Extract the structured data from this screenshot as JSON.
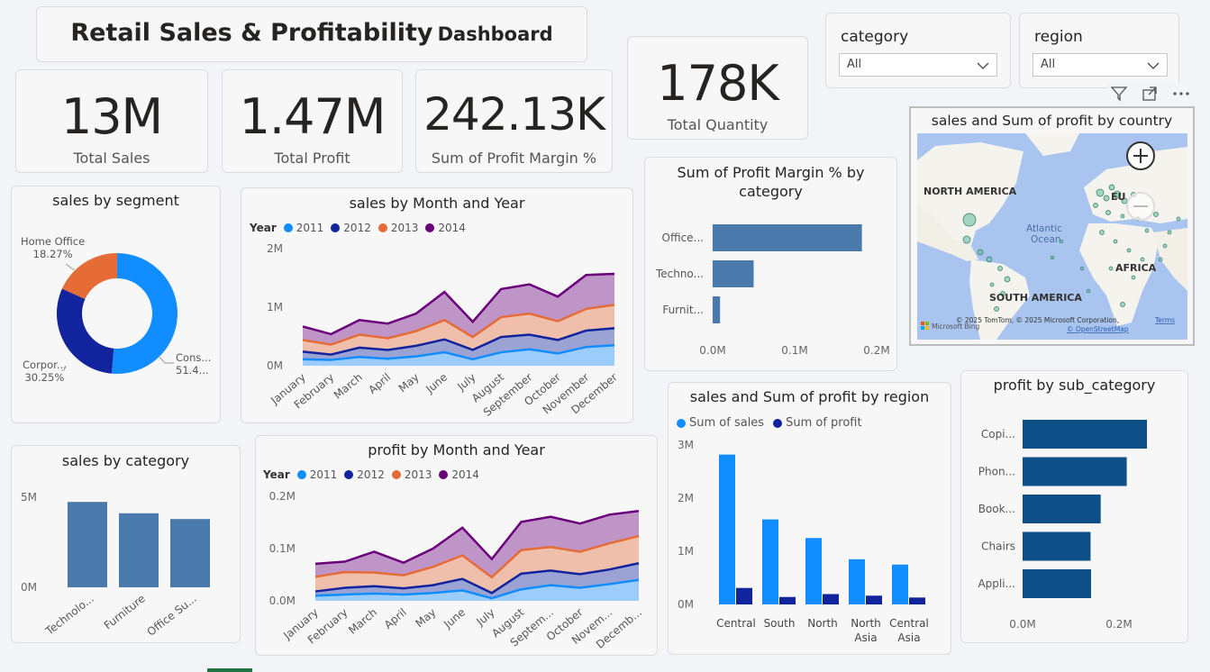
{
  "dashboard": {
    "title_main": "Retail Sales & Profitability",
    "title_sub": "Dashboard"
  },
  "kpis": [
    {
      "value": "13M",
      "label": "Total Sales"
    },
    {
      "value": "1.47M",
      "label": "Total Profit"
    },
    {
      "value": "242.13K",
      "label": "Sum of Profit Margin %"
    },
    {
      "value": "178K",
      "label": "Total Quantity"
    }
  ],
  "slicers": {
    "category": {
      "title": "category",
      "value": "All"
    },
    "region": {
      "title": "region",
      "value": "All"
    }
  },
  "colors": {
    "y2011": "#118dff",
    "y2012": "#12239e",
    "y2013": "#e66c37",
    "y2014": "#6b007b",
    "bar": "#4a7aab",
    "dark_bar": "#0e4f87",
    "sales_bar": "#118dff",
    "profit_bar": "#12239e"
  },
  "segment_chart": {
    "title": "sales by segment",
    "labels": [
      {
        "name": "Home Office",
        "pct": "18.27%"
      },
      {
        "name": "Corpor...",
        "pct": "30.25%"
      },
      {
        "name": "Cons...",
        "pct": "51.4..."
      }
    ],
    "chart_data": {
      "type": "pie",
      "categories": [
        "Consumer",
        "Corporate",
        "Home Office"
      ],
      "values": [
        51.48,
        30.25,
        18.27
      ],
      "colors": [
        "#118dff",
        "#12239e",
        "#e66c37"
      ]
    }
  },
  "sales_month_chart": {
    "title": "sales by Month and Year",
    "legend_title": "Year",
    "chart_data": {
      "type": "area",
      "stacked": true,
      "categories": [
        "January",
        "February",
        "March",
        "April",
        "May",
        "June",
        "July",
        "August",
        "September",
        "October",
        "November",
        "December"
      ],
      "y_ticks": [
        "0M",
        "1M",
        "2M"
      ],
      "ylim": [
        0,
        2000000
      ],
      "series": [
        {
          "name": "2011",
          "values": [
            110000,
            100000,
            150000,
            120000,
            160000,
            230000,
            110000,
            230000,
            280000,
            210000,
            320000,
            350000
          ]
        },
        {
          "name": "2012",
          "values": [
            130000,
            90000,
            160000,
            150000,
            180000,
            220000,
            160000,
            260000,
            250000,
            230000,
            280000,
            290000
          ]
        },
        {
          "name": "2013",
          "values": [
            200000,
            170000,
            220000,
            200000,
            250000,
            330000,
            220000,
            340000,
            360000,
            320000,
            370000,
            400000
          ]
        },
        {
          "name": "2014",
          "values": [
            230000,
            180000,
            250000,
            250000,
            300000,
            480000,
            260000,
            480000,
            500000,
            420000,
            580000,
            530000
          ]
        }
      ]
    }
  },
  "profit_month_chart": {
    "title": "profit by Month and Year",
    "legend_title": "Year",
    "chart_data": {
      "type": "area",
      "stacked": true,
      "categories": [
        "January",
        "February",
        "March",
        "April",
        "May",
        "June",
        "July",
        "August",
        "Septem...",
        "October",
        "Novem...",
        "Decemb..."
      ],
      "y_ticks": [
        "0.0M",
        "0.1M",
        "0.2M"
      ],
      "ylim": [
        0,
        200000
      ],
      "series": [
        {
          "name": "2011",
          "values": [
            10000,
            12000,
            14000,
            12000,
            15000,
            20000,
            5000,
            22000,
            30000,
            25000,
            32000,
            40000
          ]
        },
        {
          "name": "2012",
          "values": [
            8000,
            13000,
            14000,
            12000,
            15000,
            22000,
            10000,
            30000,
            28000,
            26000,
            28000,
            32000
          ]
        },
        {
          "name": "2013",
          "values": [
            28000,
            30000,
            26000,
            25000,
            35000,
            45000,
            30000,
            45000,
            45000,
            43000,
            50000,
            52000
          ]
        },
        {
          "name": "2014",
          "values": [
            25000,
            20000,
            40000,
            24000,
            35000,
            53000,
            35000,
            54000,
            58000,
            54000,
            55000,
            48000
          ]
        }
      ]
    }
  },
  "category_sales_chart": {
    "title": "sales by category",
    "chart_data": {
      "type": "bar",
      "categories": [
        "Technolo...",
        "Furniture",
        "Office Su..."
      ],
      "values": [
        4740000,
        4110000,
        3790000
      ],
      "y_ticks": [
        "0M",
        "5M"
      ],
      "ylim": [
        0,
        5000000
      ]
    }
  },
  "profit_margin_chart": {
    "title_line1": "Sum of Profit Margin % by",
    "title_line2": "category",
    "chart_data": {
      "type": "bar",
      "orientation": "horizontal",
      "categories": [
        "Office...",
        "Techno...",
        "Furnit..."
      ],
      "values": [
        182000,
        50000,
        9000
      ],
      "x_ticks": [
        "0.0M",
        "0.1M",
        "0.2M"
      ],
      "xlim": [
        0,
        200000
      ]
    }
  },
  "map": {
    "title": "sales and Sum of profit by country",
    "labels": {
      "north_america": "NORTH AMERICA",
      "south_america": "SOUTH AMERICA",
      "africa": "AFRICA",
      "europe": "EU",
      "ocean_line1": "Atlantic",
      "ocean_line2": "Ocean"
    },
    "attribution": "© 2025 TomTom, © 2025 Microsoft Corporation,",
    "terms": "Terms",
    "osm": "© OpenStreetMap",
    "brand": "Microsoft Bing"
  },
  "region_chart": {
    "title": "sales and Sum of profit by region",
    "legend": [
      "Sum of sales",
      "Sum of profit"
    ],
    "chart_data": {
      "type": "bar",
      "categories": [
        "Central",
        "South",
        "North",
        "North Asia",
        "Central Asia"
      ],
      "y_ticks": [
        "0M",
        "1M",
        "2M",
        "3M"
      ],
      "ylim": [
        0,
        3000000
      ],
      "series": [
        {
          "name": "Sum of sales",
          "values": [
            2820000,
            1600000,
            1250000,
            850000,
            750000
          ]
        },
        {
          "name": "Sum of profit",
          "values": [
            310000,
            140000,
            195000,
            165000,
            130000
          ]
        }
      ]
    }
  },
  "subcategory_chart": {
    "title": "profit by sub_category",
    "chart_data": {
      "type": "bar",
      "orientation": "horizontal",
      "categories": [
        "Copi...",
        "Phon...",
        "Book...",
        "Chairs",
        "Appli..."
      ],
      "values": [
        258000,
        216000,
        162000,
        141000,
        142000
      ],
      "x_ticks": [
        "0.0M",
        "0.2M"
      ],
      "xlim": [
        0,
        300000
      ]
    }
  }
}
